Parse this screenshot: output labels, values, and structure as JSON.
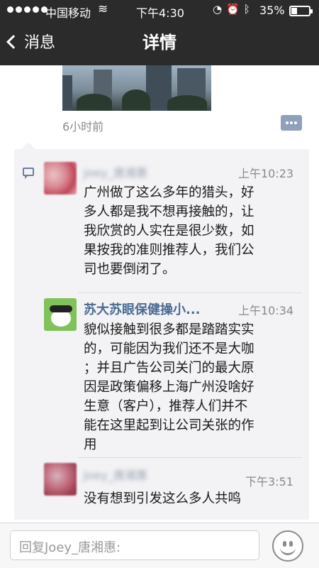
{
  "status_bar": {
    "carrier": "中国移动",
    "time": "下午4:30",
    "battery_pct": "35%",
    "battery_level": 0.35,
    "icons": [
      "wifi-icon",
      "lock-rotation-icon",
      "alarm-icon",
      "bluetooth-icon",
      "battery-icon"
    ]
  },
  "nav": {
    "back_label": "消息",
    "title": "详情"
  },
  "post": {
    "time_ago": "6小时前"
  },
  "comments": [
    {
      "name": "Joey_唐湘惠",
      "time": "上午10:23",
      "text": "广州做了这么多年的猎头，好\n多人都是我不想再接触的，让\n我欣赏的人实在是很少数，如\n果按我的准则推荐人，我们公\n司也要倒闭了。"
    },
    {
      "name": "苏大苏眼保健操小...",
      "time": "上午10:34",
      "text": "貌似接触到很多都是踏踏实实\n的，可能因为我们还不是大咖\n；并且广告公司关门的最大原\n因是政策偏移上海广州没啥好\n生意（客户），推荐人们并不\n能在这里起到让公司关张的作\n用"
    },
    {
      "name": "Joey_唐湘惠",
      "time": "下午3:51",
      "text": "没有想到引发这么多人共鸣"
    }
  ],
  "reply": {
    "placeholder": "回复Joey_唐湘惠:"
  },
  "colors": {
    "nav_bg": "#2b2b2b",
    "panel_bg": "#f3f3f5",
    "name_link": "#4b6a93"
  }
}
